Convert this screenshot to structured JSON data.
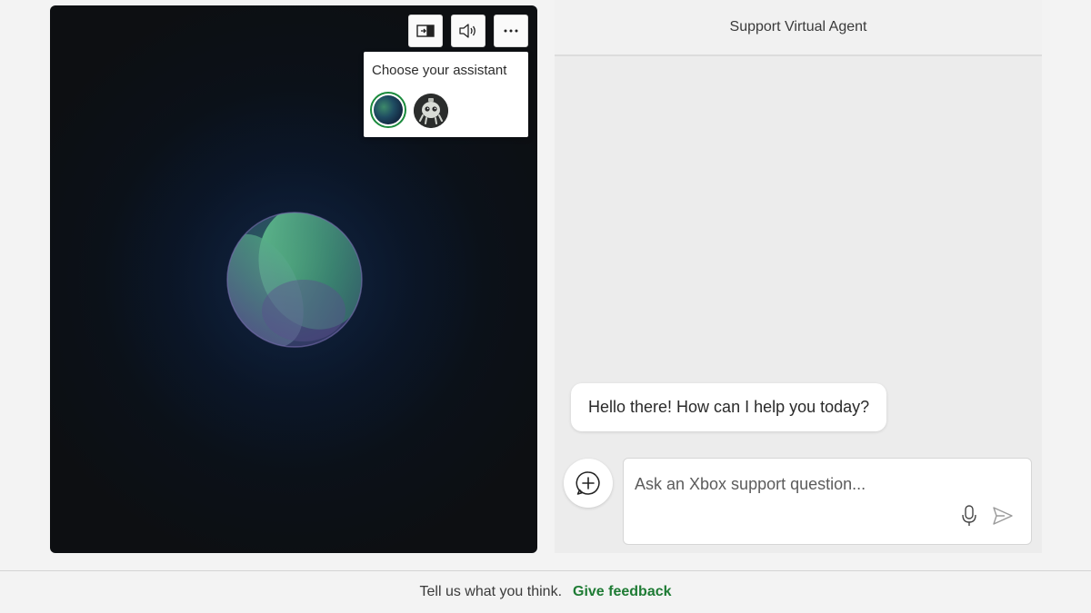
{
  "assistant": {
    "popup_title": "Choose your assistant",
    "buttons": [
      {
        "icon": "panel-toggle-icon"
      },
      {
        "icon": "speaker-icon"
      },
      {
        "icon": "more-options-icon"
      }
    ],
    "options": [
      {
        "icon": "orb-avatar-icon",
        "selected": true
      },
      {
        "icon": "robot-avatar-icon",
        "selected": false
      }
    ]
  },
  "chat": {
    "title": "Support Virtual Agent",
    "messages": [
      {
        "from": "bot",
        "text": "Hello there! How can I help you today?"
      }
    ],
    "input": {
      "placeholder": "Ask an Xbox support question...",
      "value": ""
    },
    "icons": {
      "add": "add-circle-icon",
      "mic": "microphone-icon",
      "send": "send-icon"
    }
  },
  "footer": {
    "prompt": "Tell us what you think.",
    "link": "Give feedback"
  },
  "colors": {
    "accent_green": "#1e7b34",
    "selected_ring": "#1a8a3c",
    "video_background": "#0d0f12",
    "chat_background": "#ececec"
  }
}
